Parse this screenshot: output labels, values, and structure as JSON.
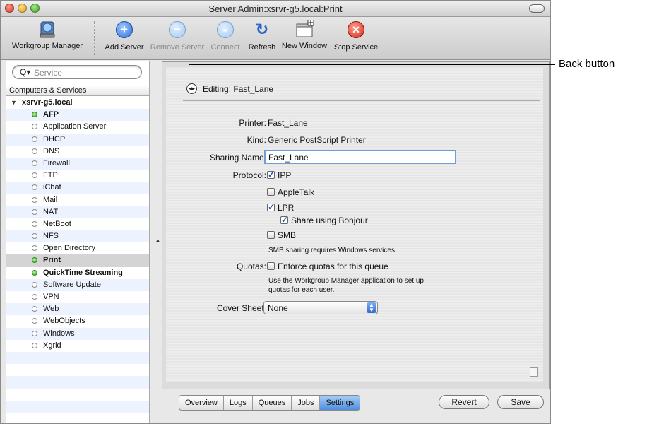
{
  "window": {
    "title": "Server Admin:xsrvr-g5.local:Print"
  },
  "toolbar": {
    "workgroup_manager": "Workgroup Manager",
    "add_server": "Add Server",
    "remove_server": "Remove Server",
    "connect": "Connect",
    "refresh": "Refresh",
    "new_window": "New Window",
    "stop_service": "Stop Service"
  },
  "sidebar": {
    "search_placeholder": "Service",
    "header": "Computers & Services",
    "server": "xsrvr-g5.local",
    "items": [
      {
        "label": "AFP",
        "running": true,
        "bold": true
      },
      {
        "label": "Application Server",
        "running": false,
        "bold": false
      },
      {
        "label": "DHCP",
        "running": false,
        "bold": false
      },
      {
        "label": "DNS",
        "running": false,
        "bold": false
      },
      {
        "label": "Firewall",
        "running": false,
        "bold": false
      },
      {
        "label": "FTP",
        "running": false,
        "bold": false
      },
      {
        "label": "iChat",
        "running": false,
        "bold": false
      },
      {
        "label": "Mail",
        "running": false,
        "bold": false
      },
      {
        "label": "NAT",
        "running": false,
        "bold": false
      },
      {
        "label": "NetBoot",
        "running": false,
        "bold": false
      },
      {
        "label": "NFS",
        "running": false,
        "bold": false
      },
      {
        "label": "Open Directory",
        "running": false,
        "bold": false
      },
      {
        "label": "Print",
        "running": true,
        "bold": true,
        "selected": true
      },
      {
        "label": "QuickTime Streaming",
        "running": true,
        "bold": true
      },
      {
        "label": "Software Update",
        "running": false,
        "bold": false
      },
      {
        "label": "VPN",
        "running": false,
        "bold": false
      },
      {
        "label": "Web",
        "running": false,
        "bold": false
      },
      {
        "label": "WebObjects",
        "running": false,
        "bold": false
      },
      {
        "label": "Windows",
        "running": false,
        "bold": false
      },
      {
        "label": "Xgrid",
        "running": false,
        "bold": false
      }
    ]
  },
  "editor": {
    "editing": "Editing: Fast_Lane",
    "printer_label": "Printer:",
    "printer_value": "Fast_Lane",
    "kind_label": "Kind:",
    "kind_value": "Generic PostScript Printer",
    "sharing_label": "Sharing Name:",
    "sharing_value": "Fast_Lane",
    "protocol_label": "Protocol:",
    "ipp": "IPP",
    "appletalk": "AppleTalk",
    "lpr": "LPR",
    "bonjour": "Share using Bonjour",
    "smb": "SMB",
    "smb_note": "SMB sharing requires Windows services.",
    "quotas_label": "Quotas:",
    "quotas_option": "Enforce quotas for this queue",
    "quotas_note_1": "Use the Workgroup Manager application to set up",
    "quotas_note_2": "quotas for each user.",
    "cover_label": "Cover Sheet:",
    "cover_value": "None",
    "checks": {
      "ipp": true,
      "appletalk": false,
      "lpr": true,
      "bonjour": true,
      "smb": false,
      "quotas": false
    }
  },
  "tabs": [
    "Overview",
    "Logs",
    "Queues",
    "Jobs",
    "Settings"
  ],
  "buttons": {
    "revert": "Revert",
    "save": "Save"
  },
  "callout": "Back button"
}
